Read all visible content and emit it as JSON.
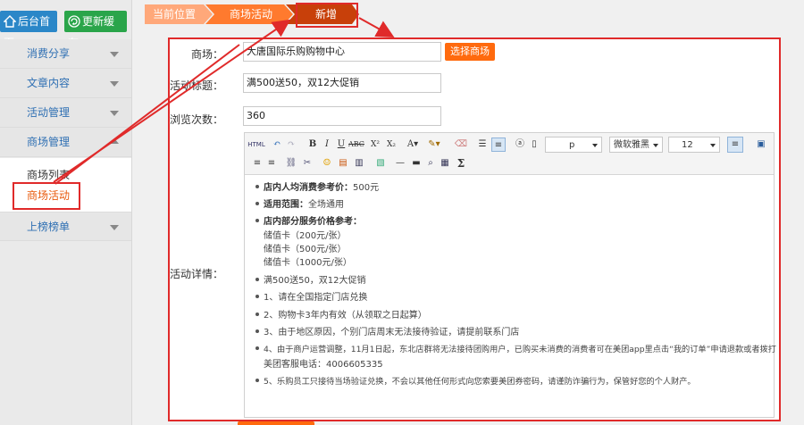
{
  "sidebar": {
    "home_label": "后台首页",
    "refresh_label": "更新缓存",
    "menus": [
      {
        "label": "消费分享"
      },
      {
        "label": "文章内容"
      },
      {
        "label": "活动管理"
      },
      {
        "label": "商场管理"
      },
      {
        "label": "上榜榜单"
      }
    ],
    "submenu": [
      {
        "label": "商场列表"
      },
      {
        "label": "商场活动"
      }
    ]
  },
  "breadcrumb": {
    "items": [
      "当前位置",
      "商场活动",
      "新增"
    ]
  },
  "form": {
    "mall_label": "商场：",
    "mall_value": "大唐国际乐购购物中心",
    "select_mall_label": "选择商场",
    "title_label": "活动标题：",
    "title_value": "满500送50，双12大促销",
    "views_label": "浏览次数：",
    "views_value": "360",
    "detail_label": "活动详情："
  },
  "editor": {
    "toolbar": {
      "html": "HTML",
      "paragraph": "p",
      "font": "微软雅黑",
      "size": "12",
      "sigma": "Σ"
    },
    "content": [
      {
        "bullet": true,
        "bold": "店内人均消费参考价：",
        "text": "500元"
      },
      {
        "bullet": true,
        "bold": "适用范围：",
        "text": "全场通用"
      },
      {
        "bullet": true,
        "bold": "店内部分服务价格参考：",
        "text": ""
      },
      {
        "bullet": false,
        "bold": "",
        "text": "储值卡（200元/张）"
      },
      {
        "bullet": false,
        "bold": "",
        "text": "储值卡（500元/张）"
      },
      {
        "bullet": false,
        "bold": "",
        "text": "储值卡（1000元/张）"
      },
      {
        "bullet": true,
        "bold": "",
        "text": "满500送50，双12大促销"
      },
      {
        "bullet": true,
        "bold": "",
        "text": "1、请在全国指定门店兑换"
      },
      {
        "bullet": true,
        "bold": "",
        "text": "2、购物卡3年内有效（从领取之日起算）"
      },
      {
        "bullet": true,
        "bold": "",
        "text": "3、由于地区原因，个别门店周末无法接待验证，请提前联系门店"
      },
      {
        "bullet": true,
        "bold": "",
        "text": "4、由于商户运营调整，11月1日起，东北店群将无法接待团购用户，已购买未消费的消费者可在美团app里点击“我的订单”申请退款或者拨打"
      },
      {
        "bullet": false,
        "bold": "",
        "text": "美团客服电话：4006605335"
      },
      {
        "bullet": true,
        "bold": "",
        "text": "5、乐购员工只接待当场验证兑换，不会以其他任何形式向您索要美团券密码，请谨防诈骗行为，保管好您的个人财产。"
      }
    ]
  },
  "colors": {
    "accent_orange": "#ff6a0e",
    "annotation_red": "#e02a2a",
    "home_blue": "#2b87c8",
    "refresh_green": "#2aa54a"
  }
}
